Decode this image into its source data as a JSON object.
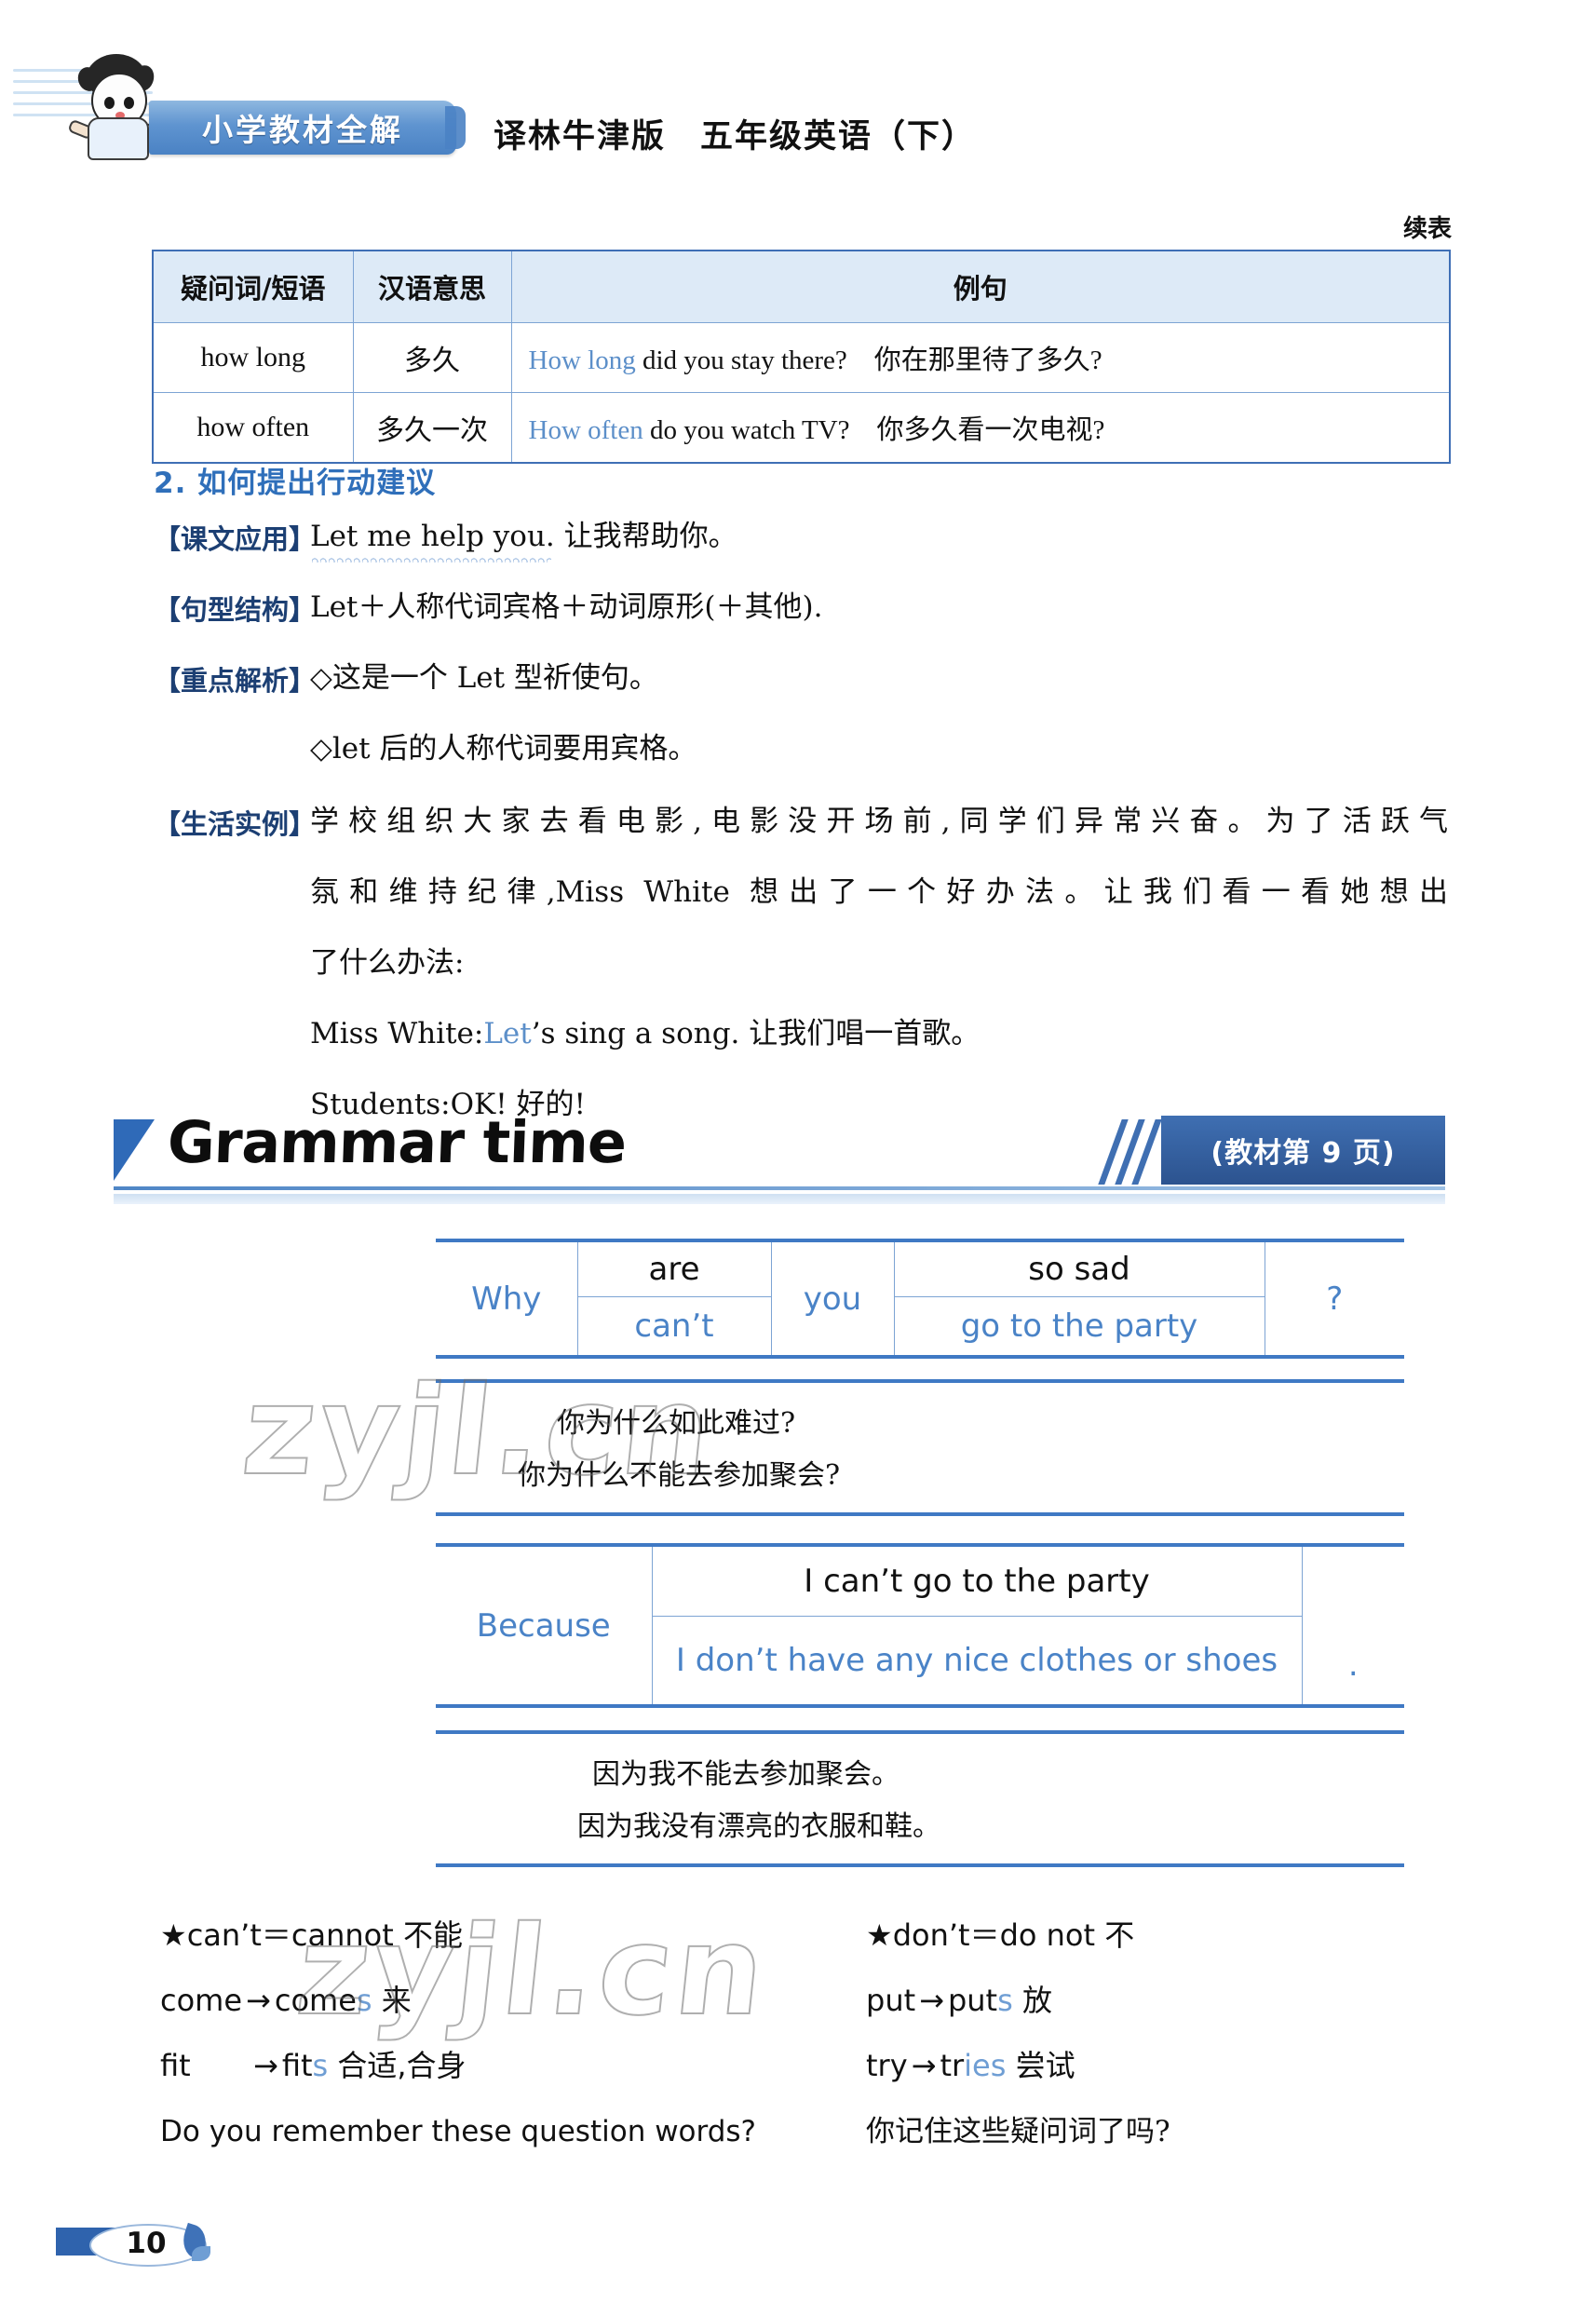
{
  "header": {
    "brand_badge": "小学教材全解",
    "book_title": "译林牛津版　五年级英语（下）",
    "continued_label": "续表",
    "mascot_icon": "boy-mascot-icon"
  },
  "question_table": {
    "columns": [
      "疑问词/短语",
      "汉语意思",
      "例句"
    ],
    "rows": [
      {
        "word": "how long",
        "meaning": "多久",
        "example_blue": "How long",
        "example_rest": " did you stay there?　你在那里待了多久?"
      },
      {
        "word": "how often",
        "meaning": "多久一次",
        "example_blue": "How often",
        "example_rest": " do you watch TV?　你多久看一次电视?"
      }
    ]
  },
  "section2": {
    "heading": "2. 如何提出行动建议",
    "rows": [
      {
        "tag": "【课文应用】",
        "text_en": "Let me help you.",
        "text_cn": " 让我帮助你。"
      },
      {
        "tag": "【句型结构】",
        "text": "Let＋人称代词宾格＋动词原形(＋其他)."
      },
      {
        "tag": "【重点解析】",
        "text": "◇这是一个 Let 型祈使句。"
      }
    ],
    "analysis_line2": "◇let 后的人称代词要用宾格。",
    "example_tag": "【生活实例】",
    "example_lines": [
      "学校组织大家去看电影,电影没开场前,同学们异常兴奋。为了活跃气",
      "氛和维持纪律,Miss White 想出了一个好办法。让我们看一看她想出",
      "了什么办法:"
    ],
    "dialogue": [
      {
        "speaker": "Miss White:",
        "blue": "Let",
        "rest": "’s sing a song. 让我们唱一首歌。"
      },
      {
        "speaker": "Students:",
        "blue": "",
        "rest": "OK! 好的!"
      }
    ]
  },
  "grammar_time": {
    "title": "Grammar time",
    "badge": "(教材第 9 页)",
    "table1": {
      "lead": "Why",
      "col_a_top": "are",
      "col_a_bottom": "can’t",
      "col_b": "you",
      "col_c_top": "so sad",
      "col_c_bottom": "go to the party",
      "end": "?"
    },
    "table1_translations": [
      "你为什么如此难过?",
      "你为什么不能去参加聚会?"
    ],
    "table2": {
      "lead": "Because",
      "top": "I can’t go to the party",
      "bottom": "I don’t have any nice clothes or shoes",
      "end": "."
    },
    "table2_translations": [
      "因为我不能去参加聚会。",
      "因为我没有漂亮的衣服和鞋。"
    ]
  },
  "notes": {
    "left": [
      {
        "star": "★",
        "text": "can’t＝cannot 不能"
      },
      {
        "base": "come",
        "arrow": "→",
        "infl_stem": "come",
        "infl_s": "s",
        "cn": " 来"
      },
      {
        "base": "fit",
        "arrow": "→",
        "infl_stem": "fit",
        "infl_s": "s",
        "cn": " 合适,合身"
      }
    ],
    "right": [
      {
        "star": "★",
        "text": "don’t＝do not 不"
      },
      {
        "base": "put",
        "arrow": "→",
        "infl_stem": "put",
        "infl_s": "s",
        "cn": " 放"
      },
      {
        "base": "try",
        "arrow": "→",
        "infl_stem": "tr",
        "infl_s": "ies",
        "cn": " 尝试"
      }
    ],
    "footer_question_en": "Do you remember these question words?",
    "footer_question_cn": "你记住这些疑问词了吗?"
  },
  "footer": {
    "page_number": "10",
    "leaf_icon": "leaf-icon"
  },
  "watermark": {
    "text": "zyjl.cn"
  },
  "colors": {
    "accent_blue": "#3f79c4",
    "text_blue": "#4a83c7",
    "header_bg": "#ddeaf7",
    "badge_blue": "#2c538f"
  }
}
